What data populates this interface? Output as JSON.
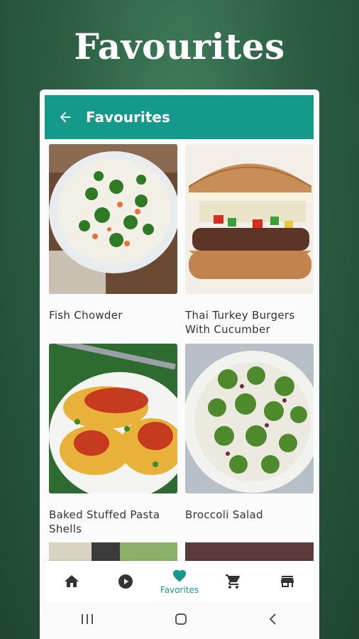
{
  "promo": {
    "headline": "Favourites"
  },
  "appbar": {
    "title": "Favourites",
    "back_icon": "arrow-back-icon"
  },
  "recipes": [
    {
      "title": "Fish Chowder"
    },
    {
      "title": "Thai Turkey Burgers With Cucumber"
    },
    {
      "title": "Baked Stuffed Pasta Shells"
    },
    {
      "title": "Broccoli Salad"
    }
  ],
  "bottom_nav": {
    "items": [
      {
        "icon": "home-icon",
        "label": ""
      },
      {
        "icon": "play-circle-icon",
        "label": ""
      },
      {
        "icon": "heart-icon",
        "label": "Favorites",
        "active": true
      },
      {
        "icon": "cart-icon",
        "label": ""
      },
      {
        "icon": "store-icon",
        "label": ""
      }
    ]
  },
  "colors": {
    "primary": "#14998a",
    "background_dark": "#1f4532",
    "background_light": "#3f7d5a"
  }
}
